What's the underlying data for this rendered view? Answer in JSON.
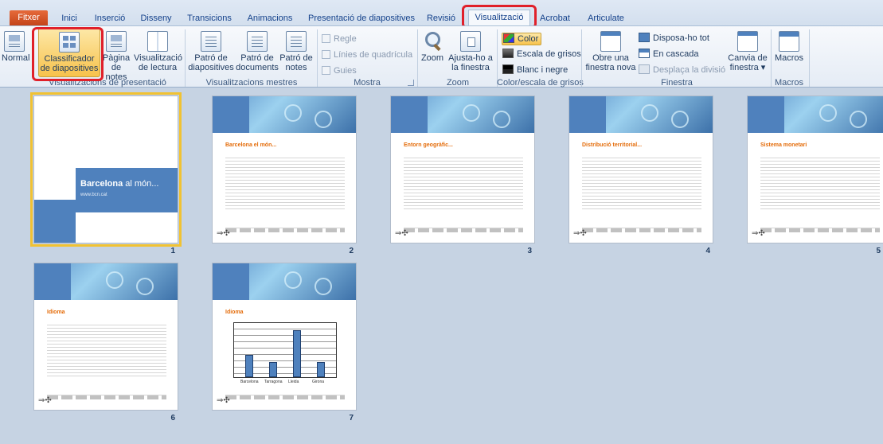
{
  "tabs": [
    {
      "label": "Fitxer"
    },
    {
      "label": "Inici"
    },
    {
      "label": "Inserció"
    },
    {
      "label": "Disseny"
    },
    {
      "label": "Transicions"
    },
    {
      "label": "Animacions"
    },
    {
      "label": "Presentació de diapositives"
    },
    {
      "label": "Revisió"
    },
    {
      "label": "Visualització"
    },
    {
      "label": "Acrobat"
    },
    {
      "label": "Articulate"
    }
  ],
  "ribbon": {
    "presentation_views": {
      "normal": "Normal",
      "sorter_1": "Classificador",
      "sorter_2": "de diapositives",
      "notes_1": "Pàgina",
      "notes_2": "de notes",
      "reading_1": "Visualització",
      "reading_2": "de lectura",
      "label": "Visualitzacions de presentació"
    },
    "master_views": {
      "slide_1": "Patró de",
      "slide_2": "diapositives",
      "handout_1": "Patró de",
      "handout_2": "documents",
      "notes_1": "Patró de",
      "notes_2": "notes",
      "label": "Visualitzacions mestres"
    },
    "show": {
      "ruler": "Regle",
      "gridlines": "Línies de quadrícula",
      "guides": "Guies",
      "label": "Mostra"
    },
    "zoom": {
      "zoom": "Zoom",
      "fit_1": "Ajusta-ho a",
      "fit_2": "la finestra",
      "label": "Zoom"
    },
    "color": {
      "color": "Color",
      "grayscale": "Escala de grisos",
      "bw": "Blanc i negre",
      "label": "Color/escala de grisos"
    },
    "window": {
      "new_1": "Obre una",
      "new_2": "finestra nova",
      "arrange": "Disposa-ho tot",
      "cascade": "En cascada",
      "split": "Desplaça la divisió",
      "switch_1": "Canvia de",
      "switch_2": "finestra ▾",
      "label": "Finestra"
    },
    "macros": {
      "macros": "Macros",
      "label": "Macros"
    }
  },
  "slides": [
    {
      "number": "1",
      "title_bold": "Barcelona",
      "title_rest": " al món...",
      "subtitle": "www.bcn.cat"
    },
    {
      "number": "2",
      "title": "Barcelona  el món..."
    },
    {
      "number": "3",
      "title": "Entorn geogràfic..."
    },
    {
      "number": "4",
      "title": "Distribució territorial..."
    },
    {
      "number": "5",
      "title": "Sistema monetari"
    },
    {
      "number": "6",
      "title": "Idioma"
    },
    {
      "number": "7",
      "title": "Idioma",
      "chart_labels": [
        "Barcelona",
        "Tarragona",
        "Lleida",
        "Girona"
      ],
      "chart_values": [
        45,
        30,
        95,
        30
      ]
    }
  ],
  "colors": {
    "accent_orange": "#e46c0a",
    "slide_blue": "#4f81bd",
    "highlight_red": "#e0202a",
    "selection_gold": "#f1c232"
  }
}
